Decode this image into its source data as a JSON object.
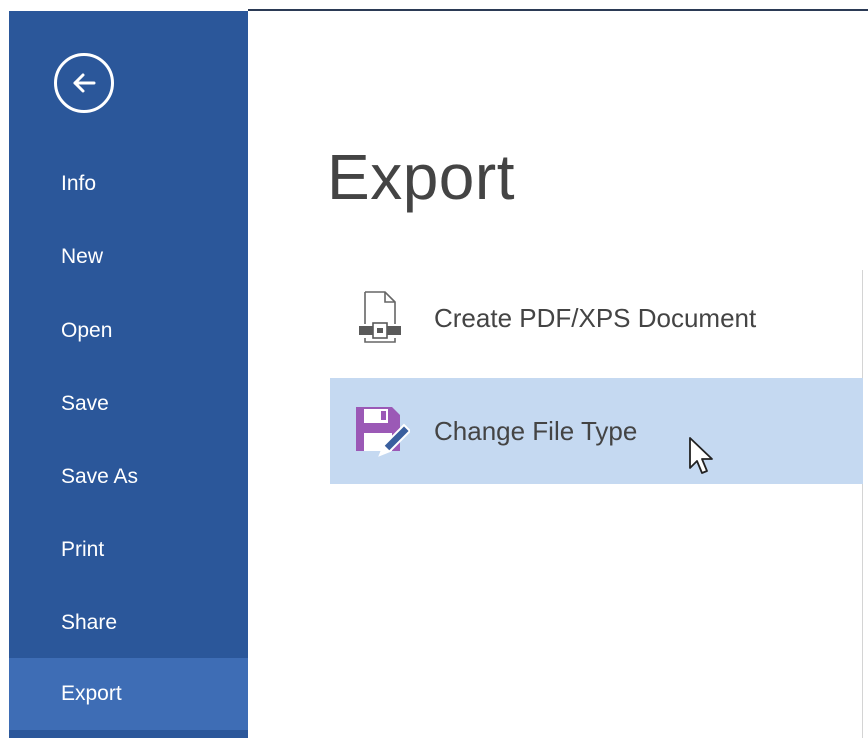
{
  "sidebar": {
    "items": [
      {
        "label": "Info"
      },
      {
        "label": "New"
      },
      {
        "label": "Open"
      },
      {
        "label": "Save"
      },
      {
        "label": "Save As"
      },
      {
        "label": "Print"
      },
      {
        "label": "Share"
      },
      {
        "label": "Export",
        "active": true
      }
    ],
    "back_icon": "back-arrow-icon"
  },
  "main": {
    "title": "Export",
    "options": [
      {
        "label": "Create PDF/XPS Document",
        "icon": "pdf-document-icon"
      },
      {
        "label": "Change File Type",
        "icon": "floppy-edit-icon",
        "highlighted": true
      }
    ]
  },
  "colors": {
    "sidebar": "#2b579a",
    "sidebar_active": "#3e6db5",
    "highlight": "#c5d9f1",
    "text": "#444444",
    "floppy": "#9b59b6"
  }
}
